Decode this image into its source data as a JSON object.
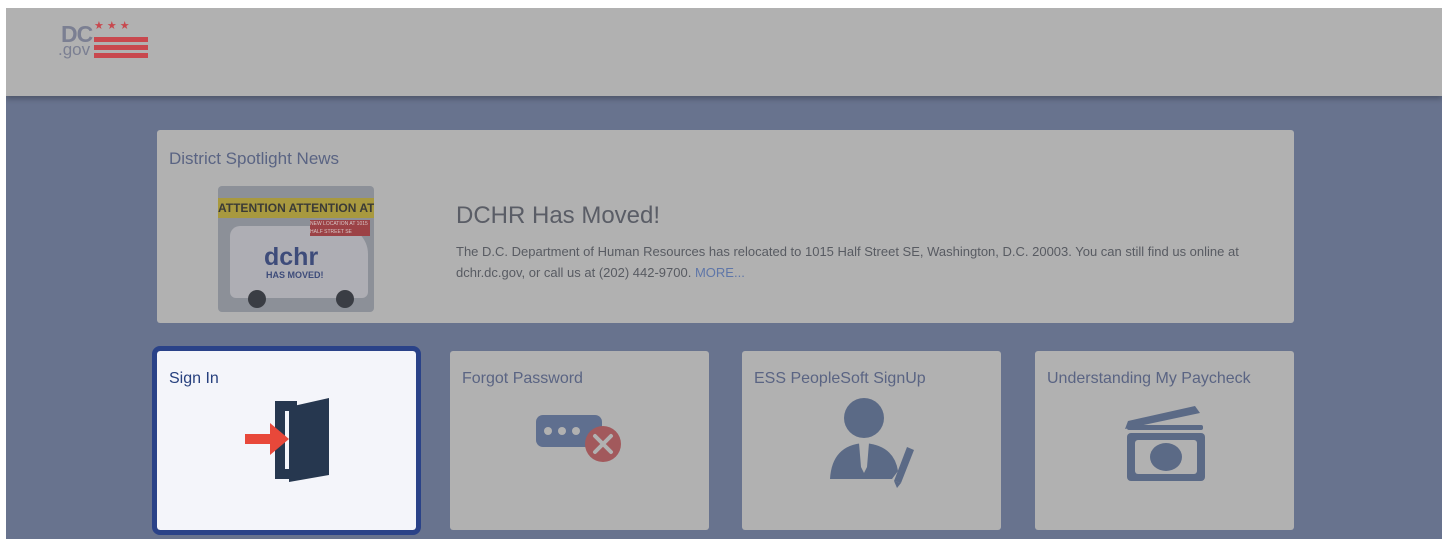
{
  "header": {
    "logo": {
      "dc": "DC",
      "gov": ".gov",
      "stars": "★★★"
    }
  },
  "news": {
    "heading": "District Spotlight News",
    "image": {
      "tape_text": "ATTENTION ATTENTION ATTENTION",
      "ribbon_text": "NEW LOCATION AT 1015 HALF STREET SE",
      "van_word": "dchr",
      "van_sub": "HAS MOVED!"
    },
    "title": "DCHR Has Moved!",
    "body": "The D.C. Department of Human Resources has relocated to 1015 Half Street SE, Washington, D.C. 20003. You can still find us online at dchr.dc.gov, or call us at (202) 442-9700.",
    "more_label": "MORE..."
  },
  "tiles": [
    {
      "label": "Sign In",
      "icon": "sign-in-door-icon"
    },
    {
      "label": "Forgot Password",
      "icon": "password-error-icon"
    },
    {
      "label": "ESS PeopleSoft SignUp",
      "icon": "user-signup-icon"
    },
    {
      "label": "Understanding My Paycheck",
      "icon": "paycheck-money-icon"
    }
  ],
  "colors": {
    "backdrop": "#68738e",
    "tile": "#b1b1b1",
    "active_tile": "#f4f5fa",
    "active_border": "#2a4288",
    "accent_red": "#e8483a"
  }
}
